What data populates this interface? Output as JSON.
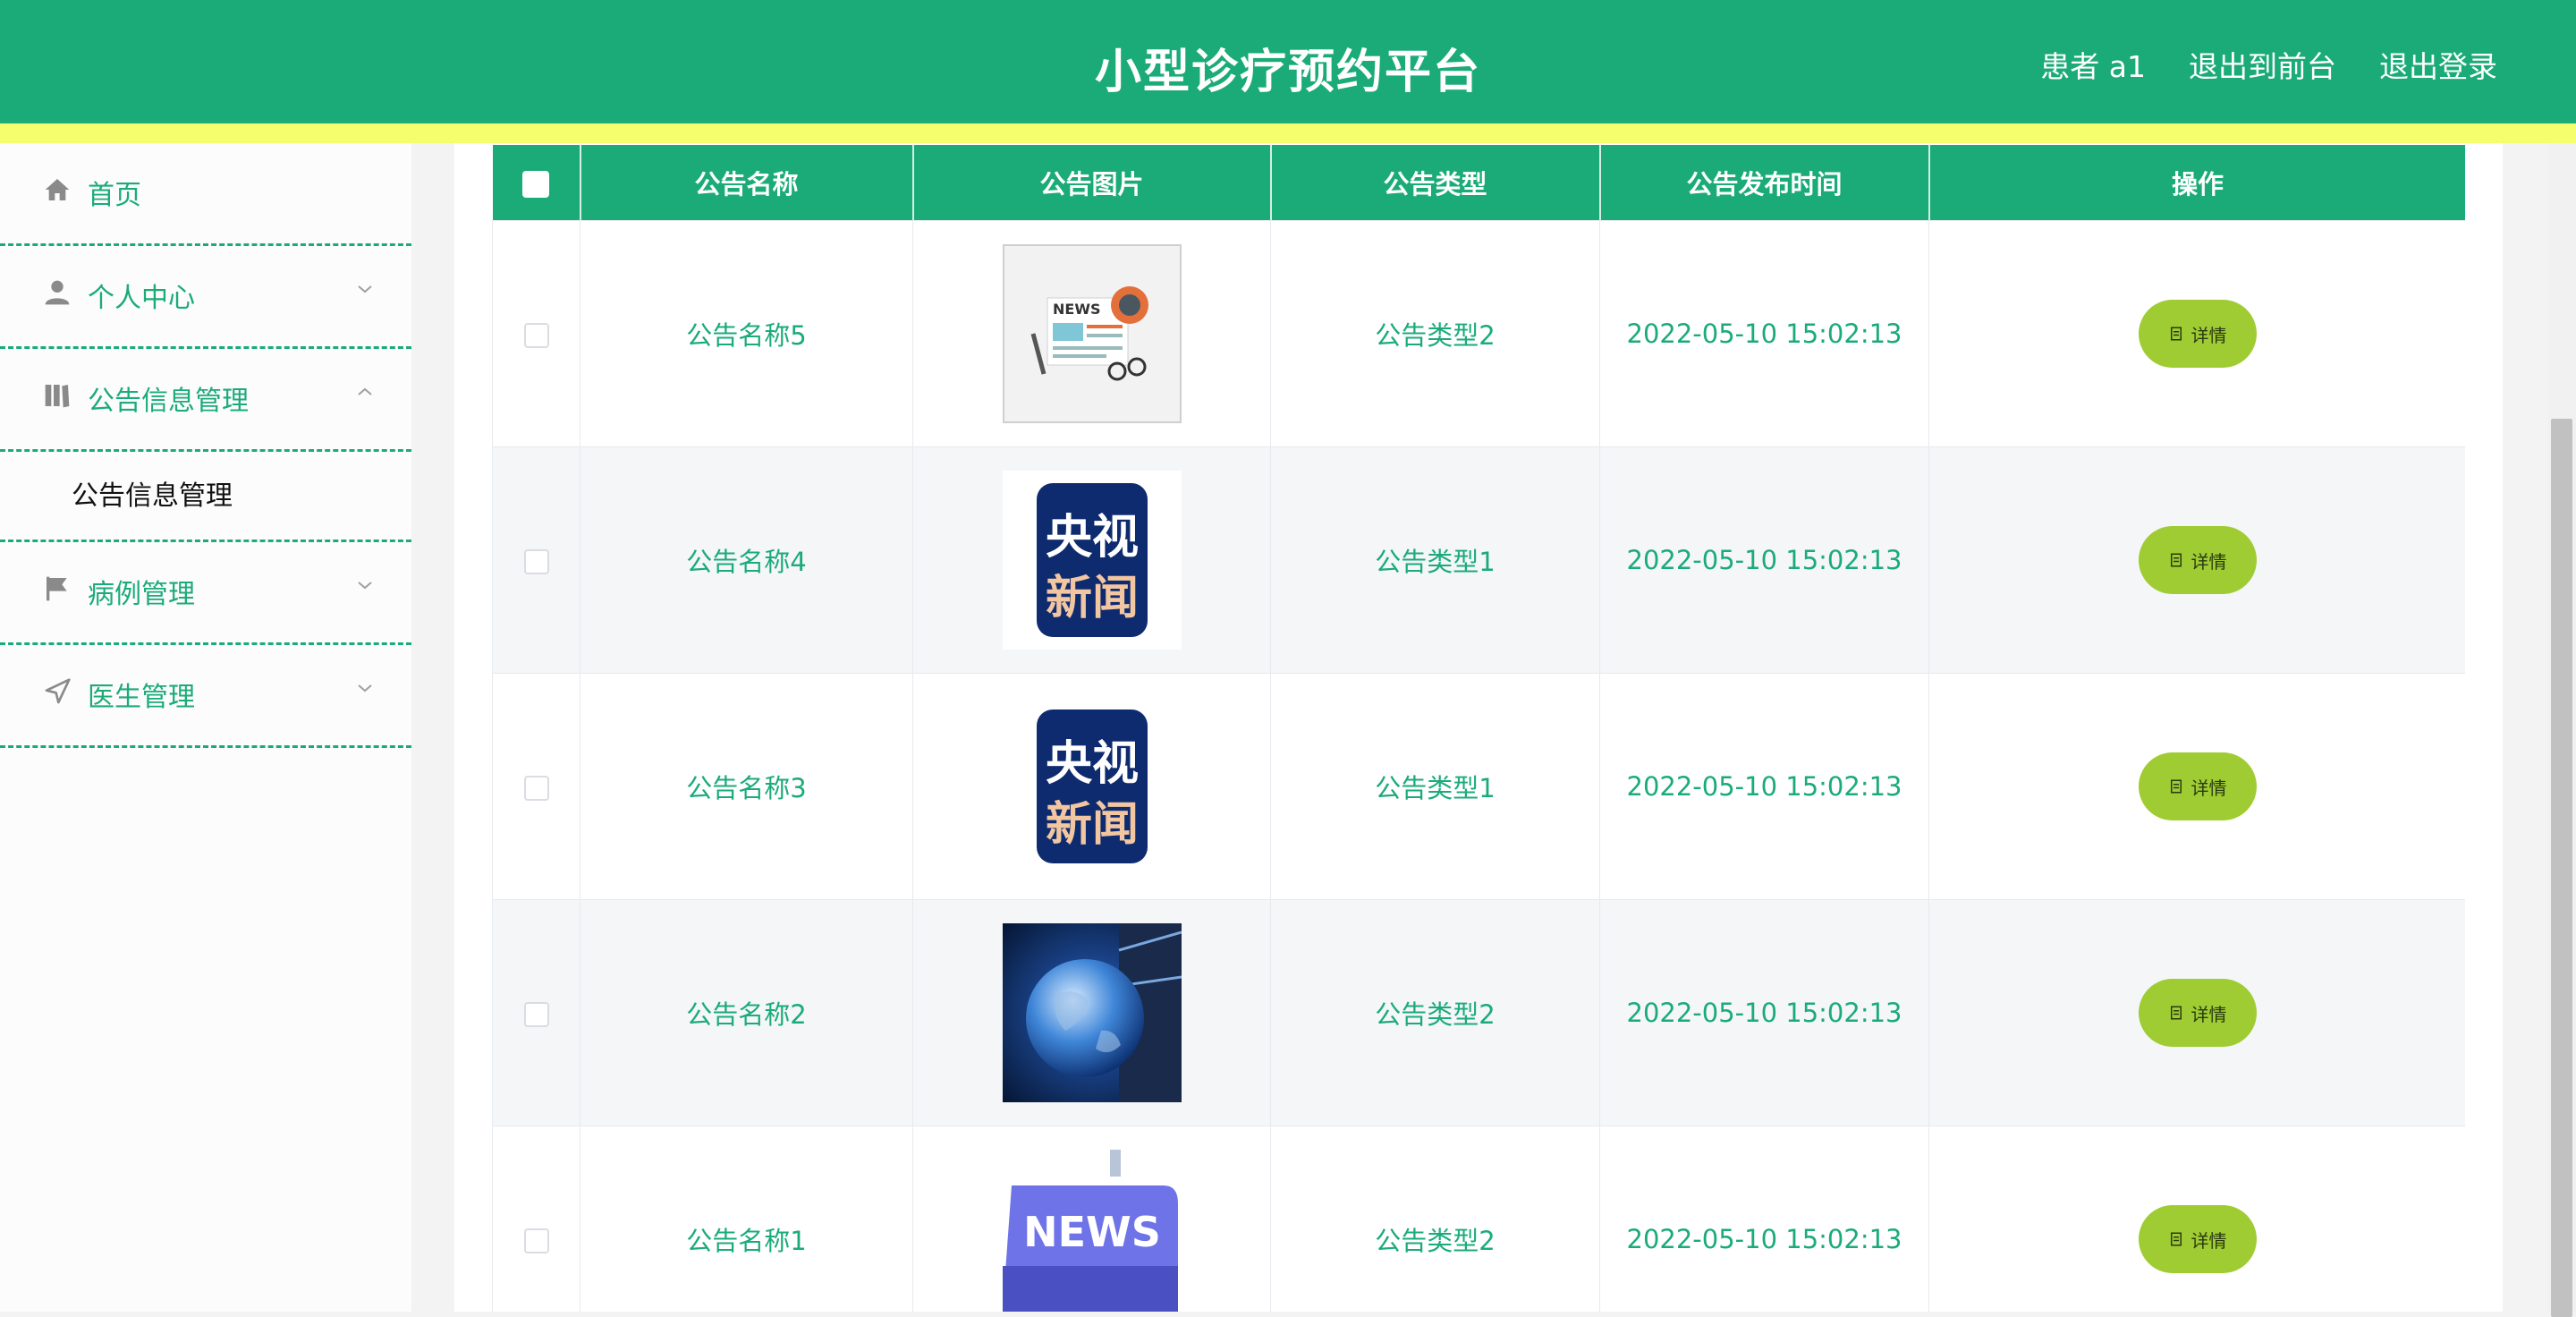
{
  "header": {
    "title": "小型诊疗预约平台",
    "user": "患者 a1",
    "to_front": "退出到前台",
    "logout": "退出登录",
    "colors": {
      "primary": "#1bab79",
      "stripe": "#f5ff6e"
    }
  },
  "sidebar": {
    "items": [
      {
        "label": "首页",
        "icon": "home-icon"
      },
      {
        "label": "个人中心",
        "icon": "user-icon",
        "chevron": "down"
      },
      {
        "label": "公告信息管理",
        "icon": "book-icon",
        "chevron": "up",
        "expanded": true,
        "sub": [
          "公告信息管理"
        ]
      },
      {
        "label": "病例管理",
        "icon": "flag-icon",
        "chevron": "down"
      },
      {
        "label": "医生管理",
        "icon": "send-icon",
        "chevron": "down"
      }
    ]
  },
  "table": {
    "columns": [
      "公告名称",
      "公告图片",
      "公告类型",
      "公告发布时间",
      "操作"
    ],
    "rows": [
      {
        "name": "公告名称5",
        "image": "newspaper-illustration",
        "type": "公告类型2",
        "time": "2022-05-10 15:02:13",
        "action": "详情"
      },
      {
        "name": "公告名称4",
        "image": "cctv-news-logo",
        "type": "公告类型1",
        "time": "2022-05-10 15:02:13",
        "action": "详情"
      },
      {
        "name": "公告名称3",
        "image": "cctv-news-logo",
        "type": "公告类型1",
        "time": "2022-05-10 15:02:13",
        "action": "详情"
      },
      {
        "name": "公告名称2",
        "image": "globe-news-studio",
        "type": "公告类型2",
        "time": "2022-05-10 15:02:13",
        "action": "详情"
      },
      {
        "name": "公告名称1",
        "image": "news-key",
        "type": "公告类型2",
        "time": "2022-05-10 15:02:13",
        "action": "详情"
      }
    ],
    "logo_text": {
      "cctv_top": "央视",
      "cctv_bottom": "新闻",
      "news": "NEWS"
    },
    "colors": {
      "action_button": "#9fcc33",
      "text": "#1bab79",
      "alt_row": "#f4f6f8"
    }
  }
}
